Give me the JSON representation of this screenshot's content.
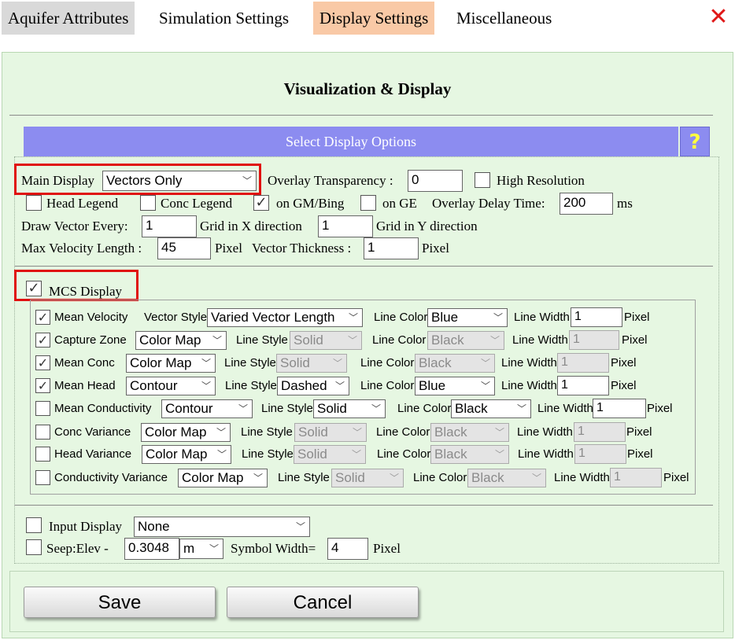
{
  "tabs": [
    {
      "label": "Aquifer Attributes",
      "bg": "#d9d9d9"
    },
    {
      "label": "Simulation Settings",
      "bg": "#ffffff"
    },
    {
      "label": "Display Settings",
      "bg": "#f9c9a6"
    },
    {
      "label": "Miscellaneous",
      "bg": "#ffffff"
    }
  ],
  "close_icon": "close-x-icon",
  "title": "Visualization & Display",
  "banner": "Select Display Options",
  "help": "?",
  "main": {
    "main_display_label": "Main Display",
    "main_display_value": "Vectors Only",
    "overlay_label": "Overlay Transparency :",
    "overlay_value": "0",
    "high_res_label": "High Resolution",
    "head_legend_label": "Head Legend",
    "conc_legend_label": "Conc Legend",
    "on_gm_label": "on GM/Bing",
    "on_ge_label": "on GE",
    "delay_label": "Overlay Delay Time:",
    "delay_value": "200",
    "delay_unit": "ms",
    "draw_vector_label": "Draw Vector Every:",
    "draw_vector_value": "1",
    "grid_x_label": "Grid in X direction",
    "grid_x_value": "1",
    "grid_y_label": "Grid in Y direction",
    "max_vel_label": "Max Velocity Length :",
    "max_vel_value": "45",
    "pixel_label": "Pixel",
    "thickness_label": "Vector Thickness :",
    "thickness_value": "1"
  },
  "mcs": {
    "label": "MCS Display",
    "checked_glyph": "✓",
    "vector_style_label": "Vector Style",
    "line_style_label": "Line Style",
    "line_color_label": "Line Color",
    "line_width_label": "Line Width",
    "pixel_label": "Pixel",
    "rows": [
      {
        "name": "Mean Velocity",
        "checked": true,
        "display": "Varied Vector Length",
        "style_label": "Vector Style",
        "style": "",
        "color": "Blue",
        "width": "1",
        "enabled": true
      },
      {
        "name": "Capture Zone",
        "checked": true,
        "display": "Color Map",
        "style_label": "Line Style",
        "style": "Solid",
        "color": "Black",
        "width": "1",
        "enabled": false
      },
      {
        "name": "Mean Conc",
        "checked": true,
        "display": "Color Map",
        "style_label": "Line Style",
        "style": "Solid",
        "color": "Black",
        "width": "1",
        "enabled": false
      },
      {
        "name": "Mean Head",
        "checked": true,
        "display": "Contour",
        "style_label": "Line Style",
        "style": "Dashed",
        "color": "Blue",
        "width": "1",
        "enabled": true
      },
      {
        "name": "Mean Conductivity",
        "checked": false,
        "display": "Contour",
        "style_label": "Line Style",
        "style": "Solid",
        "color": "Black",
        "width": "1",
        "enabled": true
      },
      {
        "name": "Conc Variance",
        "checked": false,
        "display": "Color Map",
        "style_label": "Line Style",
        "style": "Solid",
        "color": "Black",
        "width": "1",
        "enabled": false
      },
      {
        "name": "Head Variance",
        "checked": false,
        "display": "Color Map",
        "style_label": "Line Style",
        "style": "Solid",
        "color": "Black",
        "width": "1",
        "enabled": false
      },
      {
        "name": "Conductivity Variance",
        "checked": false,
        "display": "Color Map",
        "style_label": "Line Style",
        "style": "Solid",
        "color": "Black",
        "width": "1",
        "enabled": false
      }
    ]
  },
  "bottom": {
    "input_display_label": "Input Display",
    "input_display_value": "None",
    "seep_label": "Seep:Elev -",
    "seep_value": "0.3048",
    "unit_value": "m",
    "symbol_label": "Symbol Width=",
    "symbol_value": "4",
    "pixel_label": "Pixel"
  },
  "buttons": {
    "save": "Save",
    "cancel": "Cancel"
  },
  "colors": {
    "panel_bg": "#e6f7e2",
    "banner": "#8c8cf0",
    "highlight_box": "#e01010",
    "active_tab": "#f9c9a6"
  }
}
